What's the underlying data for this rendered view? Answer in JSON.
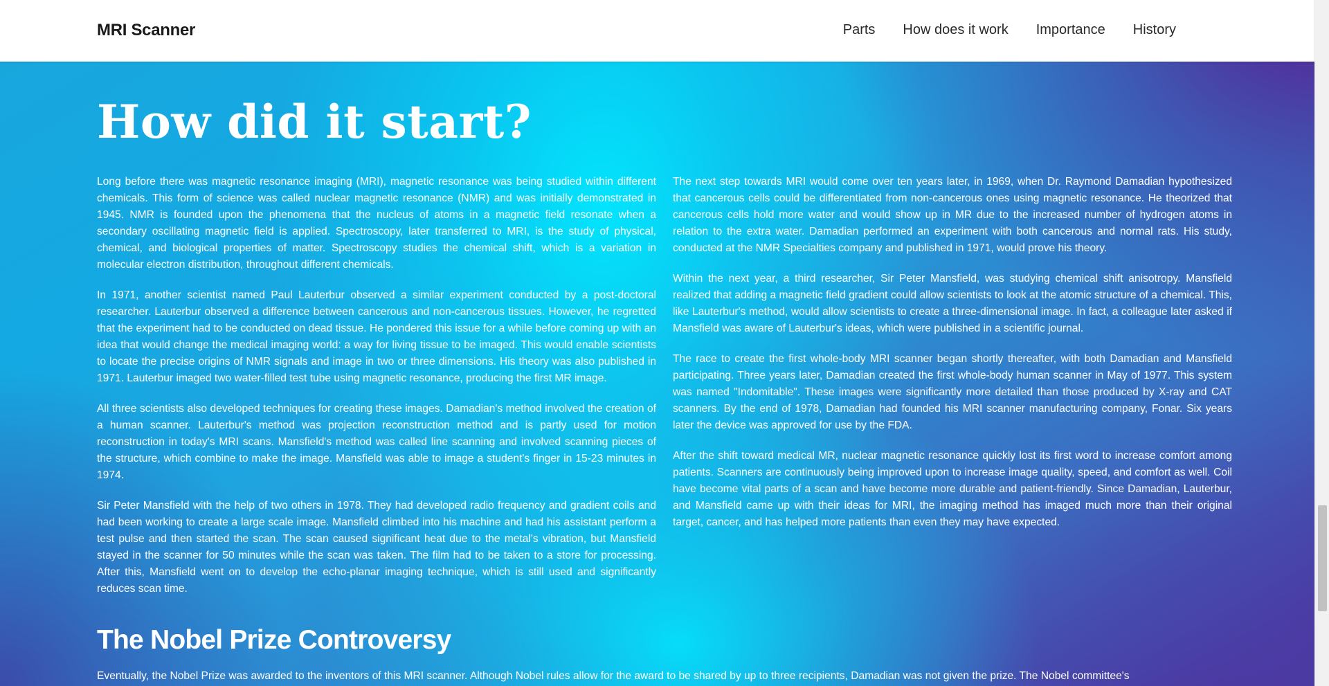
{
  "nav": {
    "brand": "MRI Scanner",
    "links": [
      "Parts",
      "How does it work",
      "Importance",
      "History"
    ]
  },
  "main": {
    "title": "How did it start?",
    "left_paragraphs": [
      "Long before there was magnetic resonance imaging (MRI), magnetic resonance was being studied within different chemicals. This form of science was called nuclear magnetic resonance (NMR) and was initially demonstrated in 1945. NMR is founded upon the phenomena that the nucleus of atoms in a magnetic field resonate when a secondary oscillating magnetic field is applied. Spectroscopy, later transferred to MRI, is the study of physical, chemical, and biological properties of matter. Spectroscopy studies the chemical shift, which is a variation in molecular electron distribution, throughout different chemicals.",
      "In 1971, another scientist named Paul Lauterbur observed a similar experiment conducted by a post-doctoral researcher. Lauterbur observed a difference between cancerous and non-cancerous tissues. However, he regretted that the experiment had to be conducted on dead tissue. He pondered this issue for a while before coming up with an idea that would change the medical imaging world: a way for living tissue to be imaged. This would enable scientists to locate the precise origins of NMR signals and image in two or three dimensions. His theory was also published in 1971. Lauterbur imaged two water-filled test tube using magnetic resonance, producing the first MR image.",
      "All three scientists also developed techniques for creating these images. Damadian's method involved the creation of a human scanner. Lauterbur's method was projection reconstruction method and is partly used for motion reconstruction in today's MRI scans. Mansfield's method was called line scanning and involved scanning pieces of the structure, which combine to make the image. Mansfield was able to image a student's finger in 15-23 minutes in 1974.",
      "Sir Peter Mansfield with the help of two others in 1978. They had developed radio frequency and gradient coils and had been working to create a large scale image. Mansfield climbed into his machine and had his assistant perform a test pulse and then started the scan. The scan caused significant heat due to the metal's vibration, but Mansfield stayed in the scanner for 50 minutes while the scan was taken. The film had to be taken to a store for processing. After this, Mansfield went on to develop the echo-planar imaging technique, which is still used and significantly reduces scan time."
    ],
    "right_paragraphs": [
      "The next step towards MRI would come over ten years later, in 1969, when Dr. Raymond Damadian hypothesized that cancerous cells could be differentiated from non-cancerous ones using magnetic resonance. He theorized that cancerous cells hold more water and would show up in MR due to the increased number of hydrogen atoms in relation to the extra water. Damadian performed an experiment with both cancerous and normal rats. His study, conducted at the NMR Specialties company and published in 1971, would prove his theory.",
      "Within the next year, a third researcher, Sir Peter Mansfield, was studying chemical shift anisotropy. Mansfield realized that adding a magnetic field gradient could allow scientists to look at the atomic structure of a chemical. This, like Lauterbur's method, would allow scientists to create a three-dimensional image. In fact, a colleague later asked if Mansfield was aware of Lauterbur's ideas, which were published in a scientific journal.",
      "The race to create the first whole-body MRI scanner began shortly thereafter, with both Damadian and Mansfield participating. Three years later, Damadian created the first whole-body human scanner in May of 1977. This system was named \"Indomitable\". These images were significantly more detailed than those produced by X-ray and CAT scanners. By the end of 1978, Damadian had founded his MRI scanner manufacturing company, Fonar. Six years later the device was approved for use by the FDA.",
      "After the shift toward medical MR, nuclear magnetic resonance quickly lost its first word to increase comfort among patients. Scanners are continuously being improved upon to increase image quality, speed, and comfort as well. Coil have become vital parts of a scan and have become more durable and patient-friendly. Since Damadian, Lauterbur, and Mansfield came up with their ideas for MRI, the imaging method has imaged much more than their original target, cancer, and has helped more patients than even they may have expected."
    ],
    "subtitle": "The Nobel Prize Controversy",
    "bottom_paragraph": "Eventually, the Nobel Prize was awarded to the inventors of this MRI scanner. Although Nobel rules allow for the award to be shared by up to three recipients, Damadian was not given the prize. The Nobel committee's"
  }
}
